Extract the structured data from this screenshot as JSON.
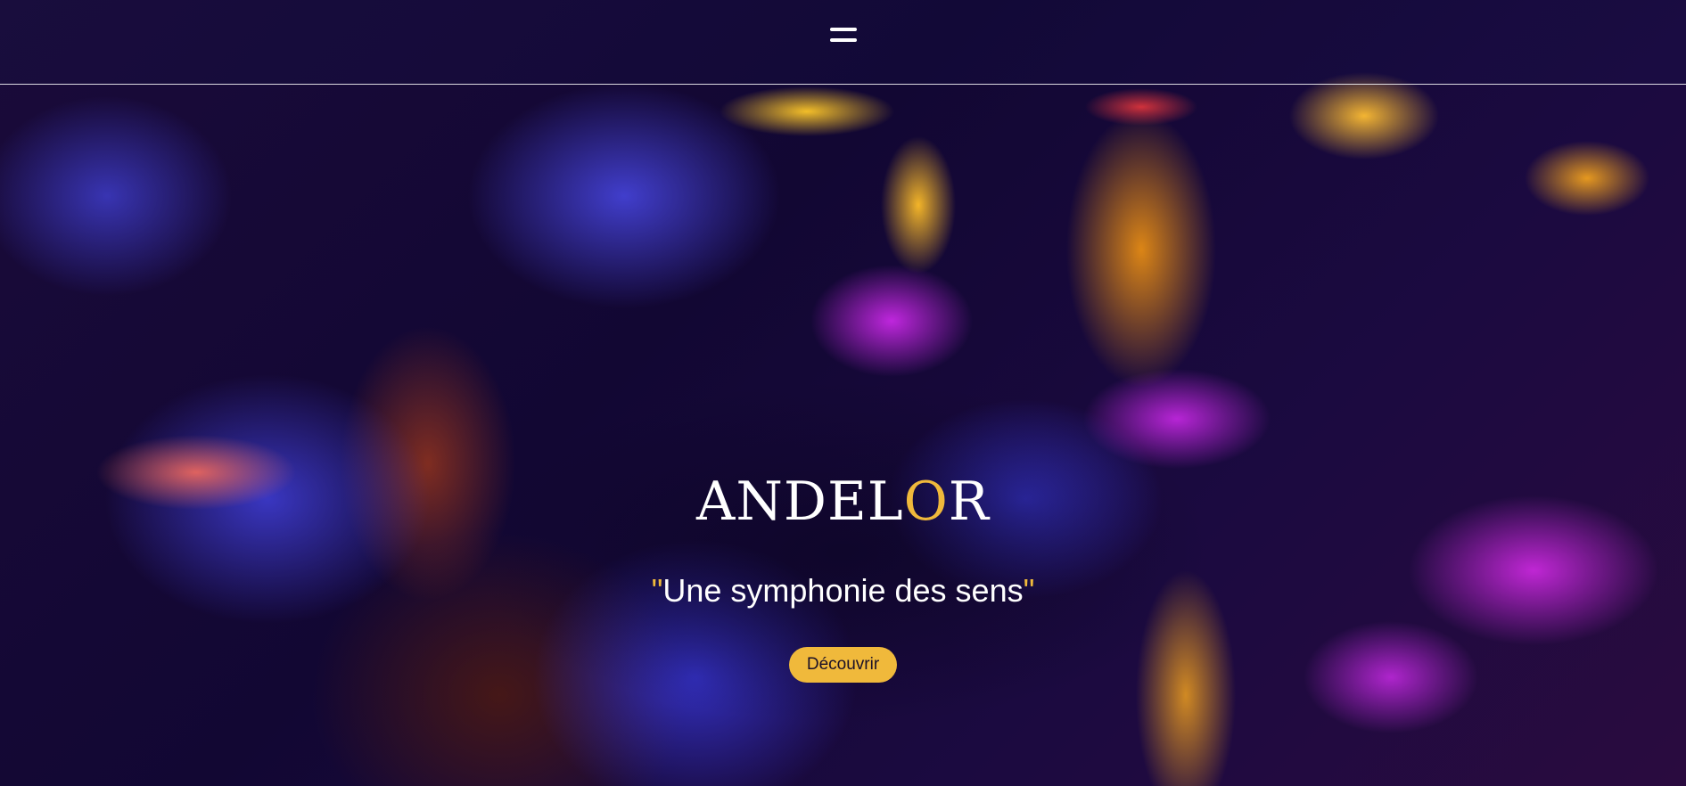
{
  "header": {
    "menu_icon": "hamburger-menu-icon"
  },
  "hero": {
    "brand_main": "ANDEL",
    "brand_accent": "O",
    "brand_tail": "R",
    "tagline_open_quote": "\"",
    "tagline_text": "Une symphonie des sens",
    "tagline_close_quote": "\"",
    "cta_label": "Découvrir"
  },
  "colors": {
    "accent": "#f0b93b",
    "text": "#ffffff",
    "header_border": "#ffffff"
  }
}
